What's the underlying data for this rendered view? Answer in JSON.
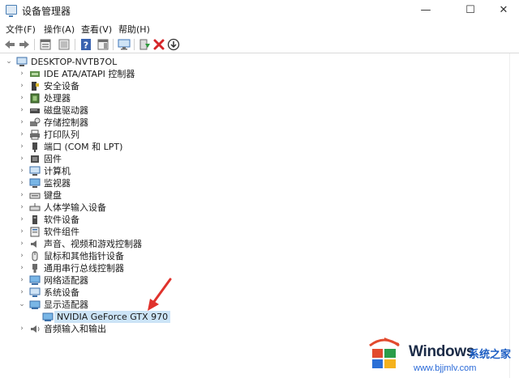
{
  "window": {
    "title": "设备管理器",
    "controls": {
      "minimize": "—",
      "maximize": "☐",
      "close": "✕"
    }
  },
  "menu": [
    {
      "label": "文件(F)"
    },
    {
      "label": "操作(A)"
    },
    {
      "label": "查看(V)"
    },
    {
      "label": "帮助(H)"
    }
  ],
  "toolbar": [
    {
      "icon": "back-arrow-icon",
      "enabled": false
    },
    {
      "icon": "forward-arrow-icon",
      "enabled": false
    },
    {
      "icon": "properties-icon"
    },
    {
      "icon": "hidden-devices-icon"
    },
    {
      "icon": "help-icon"
    },
    {
      "icon": "action-pane-icon"
    },
    {
      "icon": "scan-hardware-icon"
    },
    {
      "icon": "update-driver-icon"
    },
    {
      "icon": "uninstall-icon"
    },
    {
      "icon": "download-driver-icon"
    }
  ],
  "tree": {
    "root": {
      "label": "DESKTOP-NVTB7OL",
      "icon": "computer-icon",
      "expanded": true
    },
    "categories": [
      {
        "label": "IDE ATA/ATAPI 控制器",
        "icon": "ide-controller-icon"
      },
      {
        "label": "安全设备",
        "icon": "security-device-icon"
      },
      {
        "label": "处理器",
        "icon": "processor-icon"
      },
      {
        "label": "磁盘驱动器",
        "icon": "disk-drive-icon"
      },
      {
        "label": "存储控制器",
        "icon": "storage-controller-icon"
      },
      {
        "label": "打印队列",
        "icon": "printer-icon"
      },
      {
        "label": "端口 (COM 和 LPT)",
        "icon": "port-icon"
      },
      {
        "label": "固件",
        "icon": "firmware-icon"
      },
      {
        "label": "计算机",
        "icon": "computer-icon"
      },
      {
        "label": "监视器",
        "icon": "monitor-icon"
      },
      {
        "label": "键盘",
        "icon": "keyboard-icon"
      },
      {
        "label": "人体学输入设备",
        "icon": "hid-icon"
      },
      {
        "label": "软件设备",
        "icon": "software-device-icon"
      },
      {
        "label": "软件组件",
        "icon": "software-component-icon"
      },
      {
        "label": "声音、视频和游戏控制器",
        "icon": "sound-icon"
      },
      {
        "label": "鼠标和其他指针设备",
        "icon": "mouse-icon"
      },
      {
        "label": "通用串行总线控制器",
        "icon": "usb-icon"
      },
      {
        "label": "网络适配器",
        "icon": "network-adapter-icon"
      },
      {
        "label": "系统设备",
        "icon": "system-device-icon"
      },
      {
        "label": "显示适配器",
        "icon": "display-adapter-icon",
        "expanded": true,
        "children": [
          {
            "label": "NVIDIA GeForce GTX 970",
            "icon": "display-adapter-icon",
            "selected": true
          }
        ]
      },
      {
        "label": "音频输入和输出",
        "icon": "audio-io-icon"
      }
    ]
  },
  "annotation": {
    "icon": "red-arrow-icon",
    "color": "#e0322c"
  },
  "watermark": {
    "brand": "Windows",
    "cn": "系统之家",
    "url": "www.bjjmlv.com",
    "logo_icon": "windows-logo-icon"
  },
  "colors": {
    "selection": "#cce4f7",
    "accent": "#1e5fc4",
    "arrow": "#e0322c"
  }
}
